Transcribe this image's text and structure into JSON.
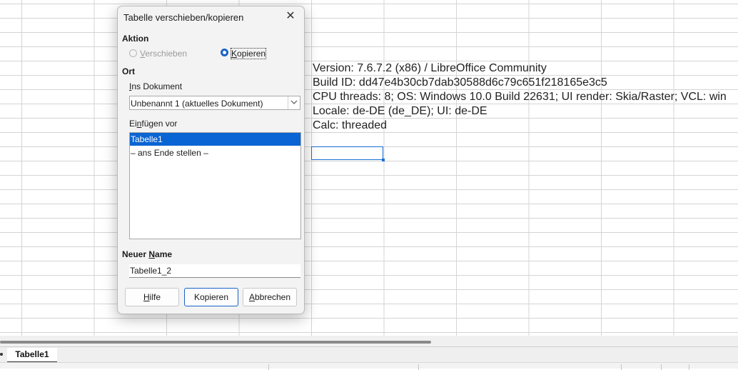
{
  "sheet": {
    "cell_lines": [
      "Version: 7.6.7.2 (x86) / LibreOffice Community",
      "Build ID: dd47e4b30cb7dab30588d6c79c651f218165e3c5",
      "CPU threads: 8; OS: Windows 10.0 Build 22631; UI render: Skia/Raster; VCL: win",
      "Locale: de-DE (de_DE); UI: de-DE",
      "Calc: threaded"
    ],
    "tab_label": "Tabelle1"
  },
  "dialog": {
    "title": "Tabelle verschieben/kopieren",
    "action_heading": "Aktion",
    "radio_move": {
      "label": "Verschieben",
      "selected": false,
      "enabled": false
    },
    "radio_copy": {
      "label": "Kopieren",
      "selected": true,
      "enabled": true
    },
    "location_heading": "Ort",
    "to_document_label": "Ins Dokument",
    "to_document_value": "Unbenannt 1 (aktuelles Dokument)",
    "insert_before_label": "Einfügen vor",
    "insert_before_items": [
      "Tabelle1",
      "– ans Ende stellen –"
    ],
    "selected_index": 0,
    "new_name_label": "Neuer Name",
    "new_name_value": "Tabelle1_2",
    "buttons": {
      "help": "Hilfe",
      "copy": "Kopieren",
      "cancel": "Abbrechen"
    }
  },
  "colors": {
    "accent": "#1a63c7",
    "selection": "#0a64d3",
    "grid": "#d4d4d4"
  },
  "icons": {
    "close": "close-icon",
    "dropdown": "chevron-down-icon"
  }
}
